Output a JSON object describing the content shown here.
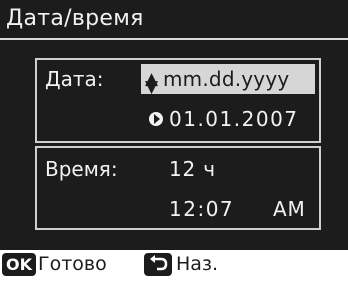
{
  "screen": {
    "title": "Дата/время"
  },
  "date_panel": {
    "label": "Дата:",
    "format_value": "mm.dd.yyyy",
    "format_icon": "up-down-arrows-icon",
    "date_value": "01.01.2007",
    "date_icon": "right-triangle-icon"
  },
  "time_panel": {
    "label": "Время:",
    "mode_value": "12 ч",
    "time_value": "12:07",
    "ampm_value": "AM"
  },
  "footer": {
    "ok_key": "OK",
    "ok_label": "Готово",
    "back_icon": "back-arrow-icon",
    "back_label": "Наз."
  },
  "colors": {
    "screen_background": "#1c1c1c",
    "text": "#f2f2f2",
    "highlight": "#d6d6d6",
    "footer_background": "#ffffff"
  }
}
